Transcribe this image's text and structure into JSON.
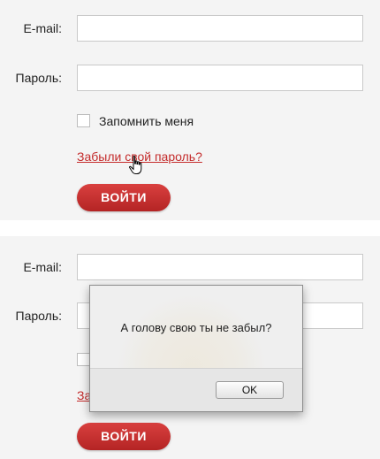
{
  "top_form": {
    "email_label": "E-mail:",
    "email_value": "",
    "password_label": "Пароль:",
    "password_value": "",
    "remember_label": "Запомнить меня",
    "remember_checked": false,
    "forgot_link": "Забыли свой пароль?",
    "login_button": "ВОЙТИ"
  },
  "bottom_form": {
    "email_label": "E-mail:",
    "password_label": "Пароль:",
    "forgot_link_partial": "За",
    "login_button": "ВОЙТИ"
  },
  "alert_dialog": {
    "message": "А голову свою ты не забыл?",
    "ok_button": "OK"
  },
  "colors": {
    "link": "#c42b2b",
    "button_red": "#c73232",
    "panel_bg": "#f4f4f4"
  }
}
